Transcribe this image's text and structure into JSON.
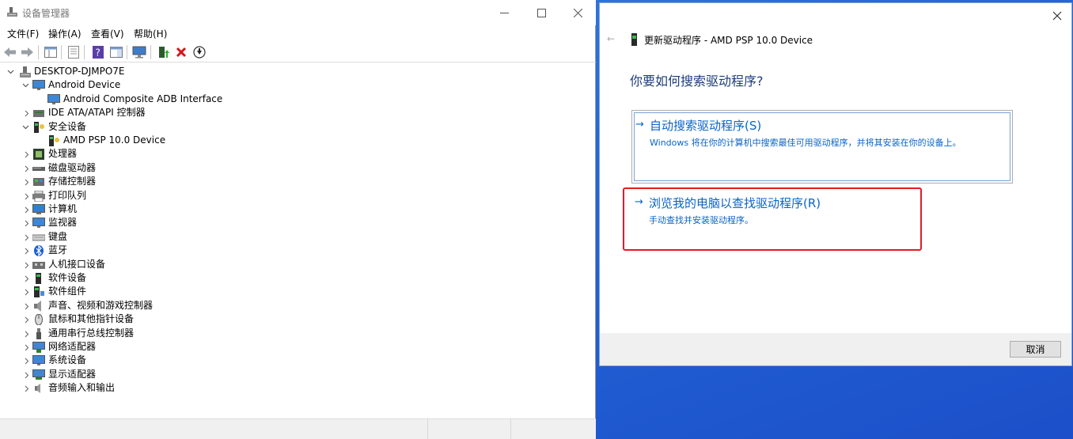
{
  "device_manager": {
    "title": "设备管理器",
    "menu": [
      "文件(F)",
      "操作(A)",
      "查看(V)",
      "帮助(H)"
    ],
    "toolbar_icons": [
      "back-arrow-icon",
      "forward-arrow-icon",
      "show-hide-tree-icon",
      "properties-icon",
      "help-icon",
      "action-pane-icon",
      "scan-hardware-icon",
      "update-driver-icon",
      "uninstall-device-icon",
      "disable-device-icon"
    ],
    "tree": {
      "root": "DESKTOP-DJMPO7E",
      "nodes": [
        {
          "label": "Android Device",
          "expanded": true,
          "icon": "monitor-icon",
          "children": [
            "Android Composite ADB Interface"
          ]
        },
        {
          "label": "IDE ATA/ATAPI 控制器",
          "expanded": false,
          "icon": "ide-controller-icon"
        },
        {
          "label": "安全设备",
          "expanded": true,
          "icon": "security-device-icon",
          "children": [
            "AMD PSP 10.0 Device"
          ]
        },
        {
          "label": "处理器",
          "expanded": false,
          "icon": "processor-icon"
        },
        {
          "label": "磁盘驱动器",
          "expanded": false,
          "icon": "disk-drive-icon"
        },
        {
          "label": "存储控制器",
          "expanded": false,
          "icon": "storage-controller-icon"
        },
        {
          "label": "打印队列",
          "expanded": false,
          "icon": "printer-icon"
        },
        {
          "label": "计算机",
          "expanded": false,
          "icon": "computer-icon"
        },
        {
          "label": "监视器",
          "expanded": false,
          "icon": "monitor-icon"
        },
        {
          "label": "键盘",
          "expanded": false,
          "icon": "keyboard-icon"
        },
        {
          "label": "蓝牙",
          "expanded": false,
          "icon": "bluetooth-icon"
        },
        {
          "label": "人机接口设备",
          "expanded": false,
          "icon": "hid-icon"
        },
        {
          "label": "软件设备",
          "expanded": false,
          "icon": "software-device-icon"
        },
        {
          "label": "软件组件",
          "expanded": false,
          "icon": "software-component-icon"
        },
        {
          "label": "声音、视频和游戏控制器",
          "expanded": false,
          "icon": "speaker-icon"
        },
        {
          "label": "鼠标和其他指针设备",
          "expanded": false,
          "icon": "mouse-icon"
        },
        {
          "label": "通用串行总线控制器",
          "expanded": false,
          "icon": "usb-icon"
        },
        {
          "label": "网络适配器",
          "expanded": false,
          "icon": "network-adapter-icon"
        },
        {
          "label": "系统设备",
          "expanded": false,
          "icon": "system-device-icon"
        },
        {
          "label": "显示适配器",
          "expanded": false,
          "icon": "display-adapter-icon"
        },
        {
          "label": "音频输入和输出",
          "expanded": false,
          "icon": "audio-io-icon"
        }
      ]
    }
  },
  "update_dialog": {
    "header_title": "更新驱动程序 - AMD PSP 10.0 Device",
    "back_glyph": "←",
    "question": "你要如何搜索驱动程序?",
    "option_arrow": "→",
    "options": [
      {
        "title": "自动搜索驱动程序(S)",
        "description": "Windows 将在你的计算机中搜索最佳可用驱动程序，并将其安装在你的设备上。"
      },
      {
        "title": "浏览我的电脑以查找驱动程序(R)",
        "description": "手动查找并安装驱动程序。"
      }
    ],
    "cancel_label": "取消"
  },
  "colors": {
    "link_blue": "#0a64c8",
    "question_blue": "#1f3d7a",
    "highlight_red": "#e31b23",
    "desktop_blue": "#2367d8"
  }
}
